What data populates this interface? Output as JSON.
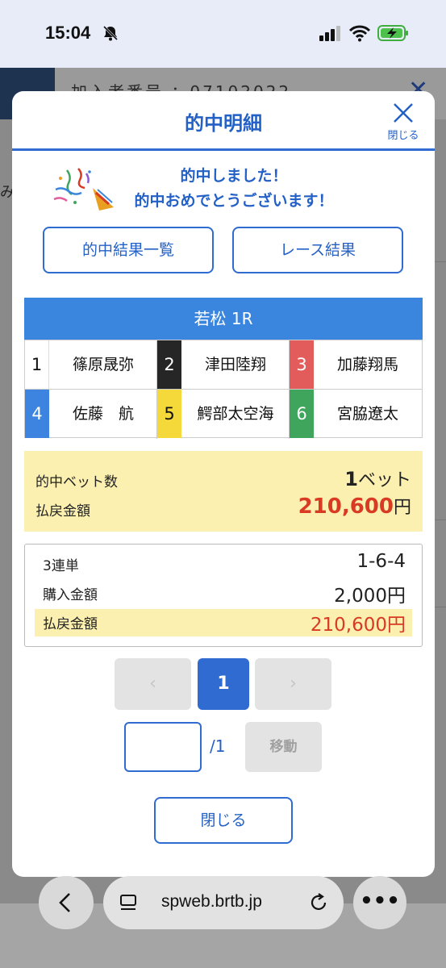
{
  "status_bar": {
    "time": "15:04"
  },
  "background": {
    "member_id": "加入者番号 ：07102022",
    "side_char": "み"
  },
  "modal": {
    "title": "的中明細",
    "close_label": "閉じる",
    "congrats_line1": "的中しました！",
    "congrats_line2": "的中おめでとうございます！",
    "results_list_button": "的中結果一覧",
    "race_result_button": "レース結果",
    "race_title": "若松 1R",
    "racers": [
      {
        "num": "1",
        "name": "篠原晟弥"
      },
      {
        "num": "2",
        "name": "津田陸翔"
      },
      {
        "num": "3",
        "name": "加藤翔馬"
      },
      {
        "num": "4",
        "name": "佐藤　航"
      },
      {
        "num": "5",
        "name": "鰐部太空海"
      },
      {
        "num": "6",
        "name": "宮脇遼太"
      }
    ],
    "summary": {
      "bet_count_label": "的中ベット数",
      "bet_count": "1",
      "bet_unit": "ベット",
      "payout_label": "払戻金額",
      "payout": "210,600",
      "payout_unit": "円"
    },
    "detail": {
      "type_label": "3連単",
      "combination": "1-6-4",
      "purchase_label": "購入金額",
      "purchase": "2,000円",
      "payout_label": "払戻金額",
      "payout": "210,600円"
    },
    "pagination": {
      "prev": "‹",
      "current": "1",
      "next": "›",
      "total": "/1",
      "move_label": "移動"
    },
    "close_button": "閉じる"
  },
  "browser": {
    "url": "spweb.brtb.jp"
  },
  "colors": {
    "accent": "#2f6bd0",
    "race_bar": "#3a86df",
    "highlight": "#fbf0b0",
    "payout_red": "#d83a24"
  }
}
